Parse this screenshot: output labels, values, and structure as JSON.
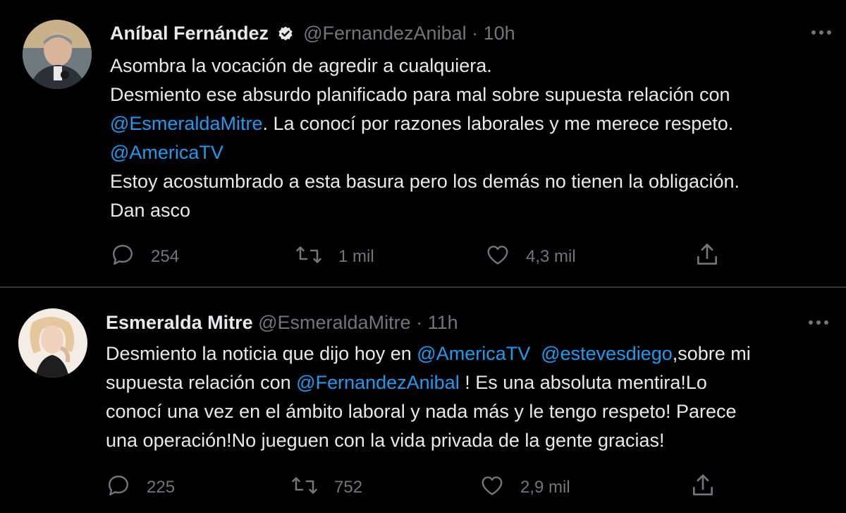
{
  "tweets": [
    {
      "author_name": "Aníbal Fernández",
      "verified": true,
      "handle": "@FernandezAnibal",
      "separator": "·",
      "time": "10h",
      "lines": [
        [
          {
            "text": "Asombra la vocación de agredir a cualquiera.",
            "mention": false
          }
        ],
        [
          {
            "text": "Desmiento ese absurdo planificado para mal sobre supuesta relación con",
            "mention": false
          }
        ],
        [
          {
            "text": "@EsmeraldaMitre",
            "mention": true
          },
          {
            "text": ". La conocí por razones laborales y me merece respeto.",
            "mention": false
          }
        ],
        [
          {
            "text": "@AmericaTV",
            "mention": true
          }
        ],
        [
          {
            "text": "Estoy acostumbrado a esta basura pero los demás no tienen la obligación.",
            "mention": false
          }
        ],
        [
          {
            "text": "Dan asco",
            "mention": false
          }
        ]
      ],
      "replies": "254",
      "retweets": "1 mil",
      "likes": "4,3 mil"
    },
    {
      "author_name": "Esmeralda Mitre",
      "verified": false,
      "handle": "@EsmeraldaMitre",
      "separator": "·",
      "time": "11h",
      "lines": [
        [
          {
            "text": "Desmiento la noticia que dijo hoy en ",
            "mention": false
          },
          {
            "text": "@AmericaTV",
            "mention": true
          },
          {
            "text": "  ",
            "mention": false
          },
          {
            "text": "@estevesdiego",
            "mention": true
          },
          {
            "text": ",sobre mi",
            "mention": false
          }
        ],
        [
          {
            "text": "supuesta relación con ",
            "mention": false
          },
          {
            "text": "@FernandezAnibal",
            "mention": true
          },
          {
            "text": " ! Es una absoluta mentira!Lo",
            "mention": false
          }
        ],
        [
          {
            "text": "conocí una vez en el ámbito laboral y nada más y le tengo respeto! Parece",
            "mention": false
          }
        ],
        [
          {
            "text": "una operación!No jueguen con la vida privada de la gente gracias!",
            "mention": false
          }
        ]
      ],
      "replies": "225",
      "retweets": "752",
      "likes": "2,9 mil"
    }
  ],
  "colors": {
    "background": "#000000",
    "text": "#e7e9ea",
    "muted": "#71767b",
    "link": "#1d9bf0",
    "divider": "#2f3336"
  },
  "icons": {
    "reply": "reply-icon",
    "retweet": "retweet-icon",
    "like": "heart-icon",
    "share": "share-icon",
    "more": "more-icon",
    "verified": "verified-badge-icon"
  }
}
